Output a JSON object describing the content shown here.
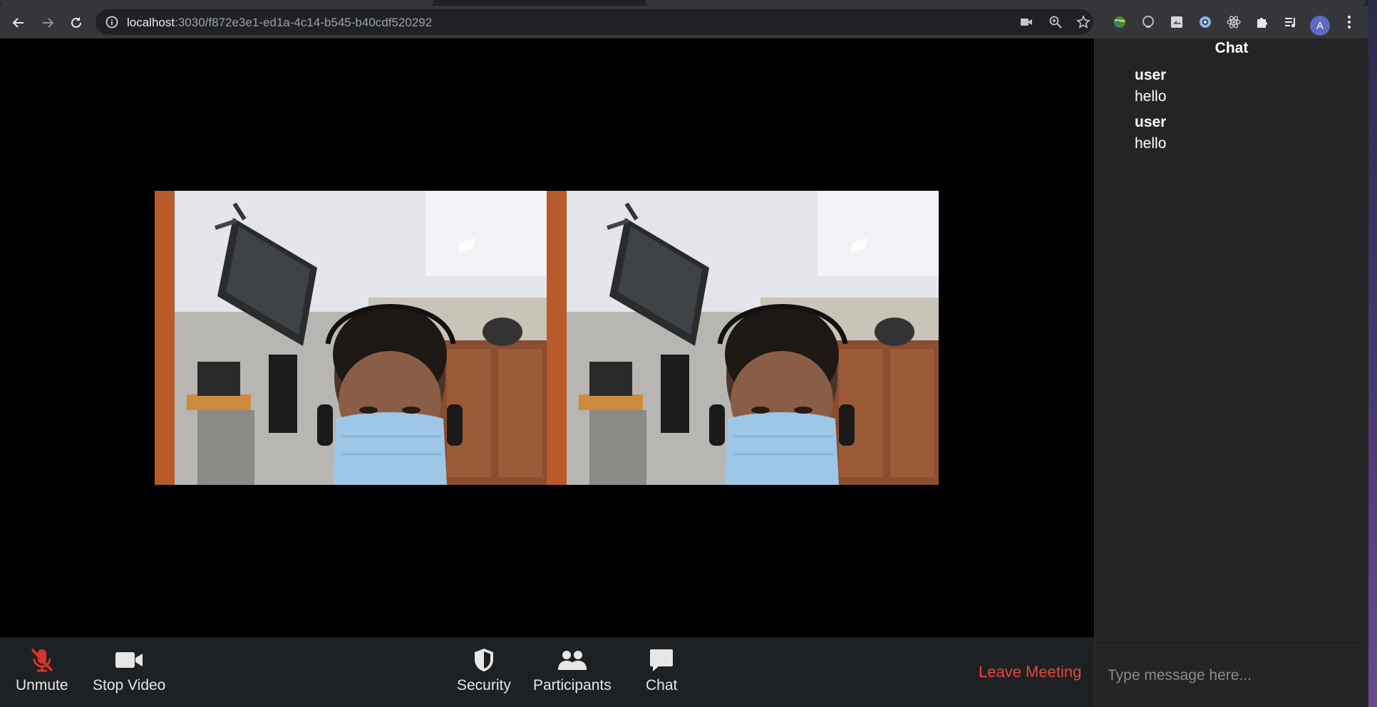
{
  "browser": {
    "url_host": "localhost",
    "url_rest": ":3030/f872e3e1-ed1a-4c14-b545-b40cdf520292",
    "profile_initial": "A"
  },
  "chat": {
    "title": "Chat",
    "messages": [
      {
        "user": "user",
        "text": "hello"
      },
      {
        "user": "user",
        "text": "hello"
      }
    ],
    "input_placeholder": "Type message here..."
  },
  "controls": {
    "unmute": "Unmute",
    "stop_video": "Stop Video",
    "security": "Security",
    "participants": "Participants",
    "chat": "Chat",
    "leave": "Leave Meeting"
  },
  "colors": {
    "leave": "#e9443c",
    "mic_muted": "#d9342b",
    "controls_bg": "#1e2124",
    "chat_bg": "#242424"
  }
}
